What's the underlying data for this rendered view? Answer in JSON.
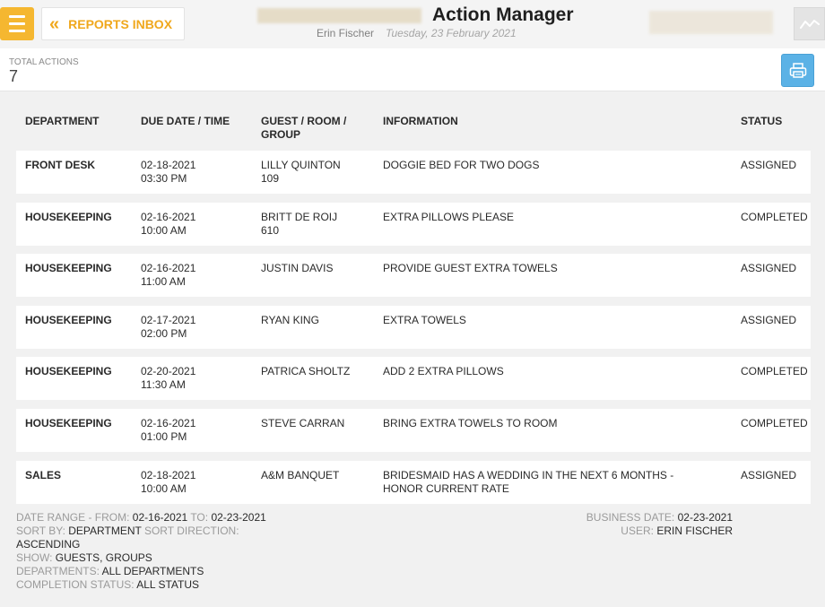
{
  "header": {
    "reports_label": "REPORTS INBOX",
    "title": "Action Manager",
    "user": "Erin Fischer",
    "date": "Tuesday, 23 February 2021"
  },
  "summary": {
    "total_label": "TOTAL ACTIONS",
    "total_value": "7"
  },
  "table": {
    "columns": [
      "DEPARTMENT",
      "DUE DATE / TIME",
      "GUEST / ROOM / GROUP",
      "INFORMATION",
      "STATUS"
    ],
    "rows": [
      {
        "department": "FRONT DESK",
        "date": "02-18-2021",
        "time": "03:30 PM",
        "guest": "LILLY QUINTON",
        "room": "109",
        "info": "DOGGIE BED FOR TWO DOGS",
        "status": "ASSIGNED"
      },
      {
        "department": "HOUSEKEEPING",
        "date": "02-16-2021",
        "time": "10:00 AM",
        "guest": "BRITT DE ROIJ",
        "room": "610",
        "info": "EXTRA PILLOWS PLEASE",
        "status": "COMPLETED"
      },
      {
        "department": "HOUSEKEEPING",
        "date": "02-16-2021",
        "time": "11:00 AM",
        "guest": "JUSTIN DAVIS",
        "room": "",
        "info": "PROVIDE GUEST EXTRA TOWELS",
        "status": "ASSIGNED"
      },
      {
        "department": "HOUSEKEEPING",
        "date": "02-17-2021",
        "time": "02:00 PM",
        "guest": "RYAN KING",
        "room": "",
        "info": "EXTRA TOWELS",
        "status": "ASSIGNED"
      },
      {
        "department": "HOUSEKEEPING",
        "date": "02-20-2021",
        "time": "11:30 AM",
        "guest": "PATRICA SHOLTZ",
        "room": "",
        "info": "ADD 2 EXTRA PILLOWS",
        "status": "COMPLETED"
      },
      {
        "department": "HOUSEKEEPING",
        "date": "02-16-2021",
        "time": "01:00 PM",
        "guest": "STEVE CARRAN",
        "room": "",
        "info": "BRING EXTRA TOWELS TO ROOM",
        "status": "COMPLETED"
      },
      {
        "department": "SALES",
        "date": "02-18-2021",
        "time": "10:00 AM",
        "guest": "A&M BANQUET",
        "room": "",
        "info": "BRIDESMAID HAS A WEDDING IN THE NEXT 6 MONTHS - HONOR CURRENT RATE",
        "status": "ASSIGNED"
      }
    ]
  },
  "footer": {
    "date_range_label": "DATE RANGE - FROM:",
    "date_from": "02-16-2021",
    "to_label": "TO:",
    "date_to": "02-23-2021",
    "sort_by_label": "SORT BY:",
    "sort_by": "DEPARTMENT",
    "sort_dir_label": "SORT DIRECTION:",
    "sort_dir": "ASCENDING",
    "show_label": "SHOW:",
    "show": "GUESTS, GROUPS",
    "departments_label": "DEPARTMENTS:",
    "departments": "ALL DEPARTMENTS",
    "completion_label": "COMPLETION STATUS:",
    "completion": "ALL STATUS",
    "business_date_label": "BUSINESS DATE:",
    "business_date": "02-23-2021",
    "user_label": "USER:",
    "user": "ERIN FISCHER"
  },
  "colors": {
    "accent": "#f5b730",
    "print_button": "#5bb2e6"
  }
}
